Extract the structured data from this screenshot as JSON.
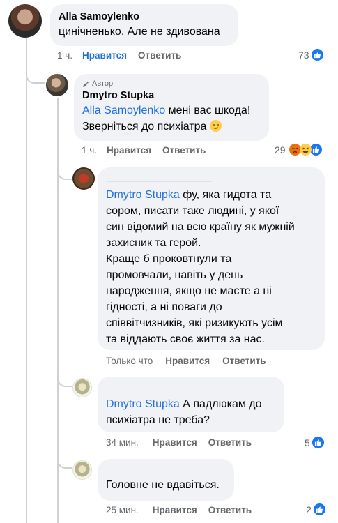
{
  "comments": [
    {
      "author": "Alla Samoylenko",
      "text": "цинічненько. Але не здивована",
      "time": "1 ч.",
      "like_label": "Нравится",
      "reply_label": "Ответить",
      "reactions": "73"
    },
    {
      "author_badge": "Автор",
      "author": "Dmytro Stupka",
      "mention": "Alla Samoylenko",
      "text_line1": " мені вас шкода!",
      "text_line2": "Зверніться до психіатра",
      "time": "1 ч.",
      "like_label": "Нравится",
      "reply_label": "Ответить",
      "reactions": "29"
    },
    {
      "mention": "Dmytro Stupka",
      "lines": [
        " фу, яка гидота та",
        "сором, писати таке людині, у якої",
        "син відомий на всю країну як мужній",
        "захисник та герой.",
        "Краще б проковтнули та",
        "промовчали, навіть у день",
        "народження, якщо не маєте а ні",
        "гідності, а ні поваги до",
        "співвітчизників, які ризикують усім",
        "та віддають своє життя за нас."
      ],
      "time": "Только что",
      "like_label": "Нравится",
      "reply_label": "Ответить"
    },
    {
      "mention": "Dmytro Stupka",
      "text_line1": " А падлюкам до",
      "text_line2": "психіатра не треба?",
      "time": "34 мин.",
      "like_label": "Нравится",
      "reply_label": "Ответить",
      "reactions": "5"
    },
    {
      "text": "Головне не вдавіться.",
      "time": "25 мин.",
      "like_label": "Нравится",
      "reply_label": "Ответить",
      "reactions": "2"
    }
  ]
}
